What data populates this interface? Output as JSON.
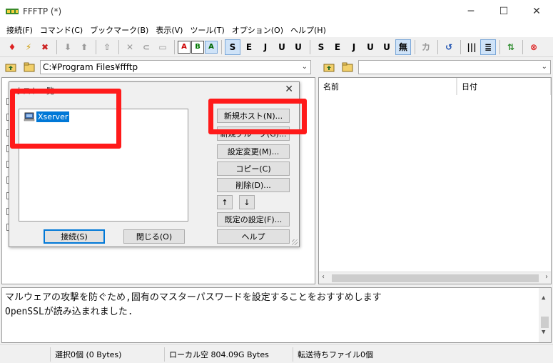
{
  "window": {
    "title": "FFFTP (*)",
    "minimize": "─",
    "maximize": "☐",
    "close": "✕"
  },
  "menu": [
    "接続(F)",
    "コマンド(C)",
    "ブックマーク(B)",
    "表示(V)",
    "ツール(T)",
    "オプション(O)",
    "ヘルプ(H)"
  ],
  "toolbar": {
    "mode_labels": [
      "A",
      "B",
      "A"
    ],
    "kanji_labels": [
      "S",
      "E",
      "J",
      "U",
      "U",
      "S",
      "E",
      "J",
      "U",
      "U"
    ],
    "none_label": "無",
    "kana_label": "カ"
  },
  "local": {
    "path": "C:¥Program Files¥ffftp"
  },
  "remote": {
    "path": "",
    "columns": [
      "名前",
      "日付"
    ]
  },
  "log": {
    "lines": [
      "マルウェアの攻撃を防ぐため,固有のマスターパスワードを設定することをおすすめします",
      "OpenSSLが読み込まれました."
    ]
  },
  "status": {
    "selected": "選択0個 (0 Bytes)",
    "local_free": "ローカル空 804.09G Bytes",
    "queue": "転送待ちファイル0個"
  },
  "dialog": {
    "title": "ホスト一覧",
    "hosts": [
      "Xserver"
    ],
    "buttons": {
      "new_host": "新規ホスト(N)...",
      "new_group": "新規グループ(G)...",
      "settings": "設定変更(M)...",
      "copy": "コピー(C)",
      "delete": "削除(D)...",
      "up": "↑",
      "down": "↓",
      "defaults": "既定の設定(F)...",
      "help": "ヘルプ",
      "connect": "接続(S)",
      "close": "閉じる(O)"
    }
  },
  "colors": {
    "annotation": "#ff1a1a",
    "selection": "#0078d7"
  }
}
